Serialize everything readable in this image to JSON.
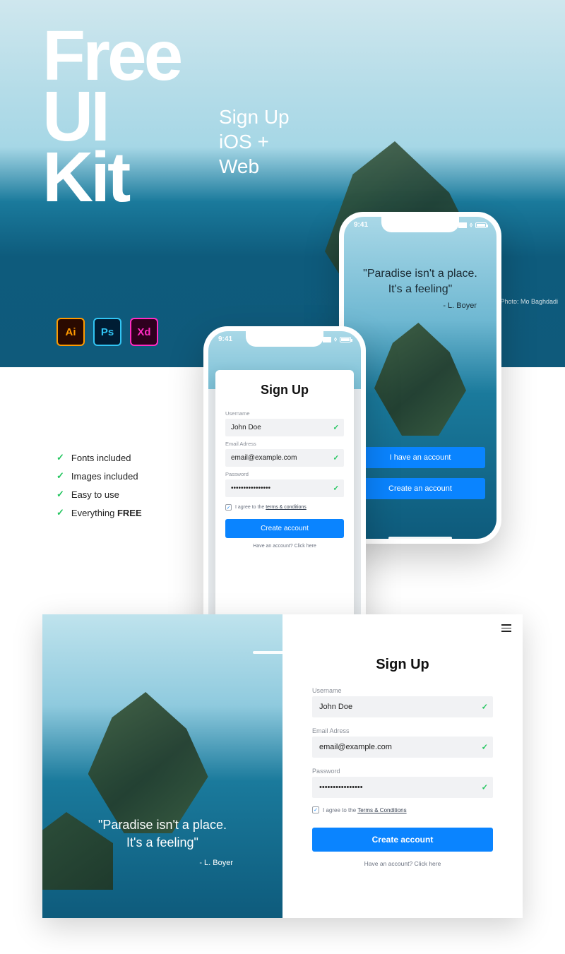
{
  "hero": {
    "title_line1": "Free",
    "title_line2": "UI",
    "title_line3": "Kit",
    "subtitle_line1": "Sign Up",
    "subtitle_line2": "iOS +",
    "subtitle_line3": "Web",
    "photo_credit": "Photo: Mo Baghdadi",
    "badges": {
      "ai": "Ai",
      "ps": "Ps",
      "xd": "Xd"
    }
  },
  "features": {
    "items": [
      "Fonts included",
      "Images included",
      "Easy to use"
    ],
    "lastPrefix": "Everything ",
    "lastBold": "FREE"
  },
  "statusTime": "9:41",
  "quote": {
    "line1": "\"Paradise isn't a place.",
    "line2": "It's a feeling\"",
    "author": "- L. Boyer"
  },
  "welcome": {
    "have_account": "I have an account",
    "create_account": "Create an account"
  },
  "signup": {
    "title": "Sign Up",
    "username_label": "Username",
    "username_value": "John Doe",
    "email_label": "Email Adress",
    "email_value": "email@example.com",
    "password_label": "Password",
    "password_value": "••••••••••••••••",
    "terms_prefix": "I agree to the ",
    "terms_link_mobile": "terms & conditions",
    "terms_link_web": "Terms & Conditions",
    "create_btn": "Create account",
    "already": "Have an account? Click here"
  }
}
